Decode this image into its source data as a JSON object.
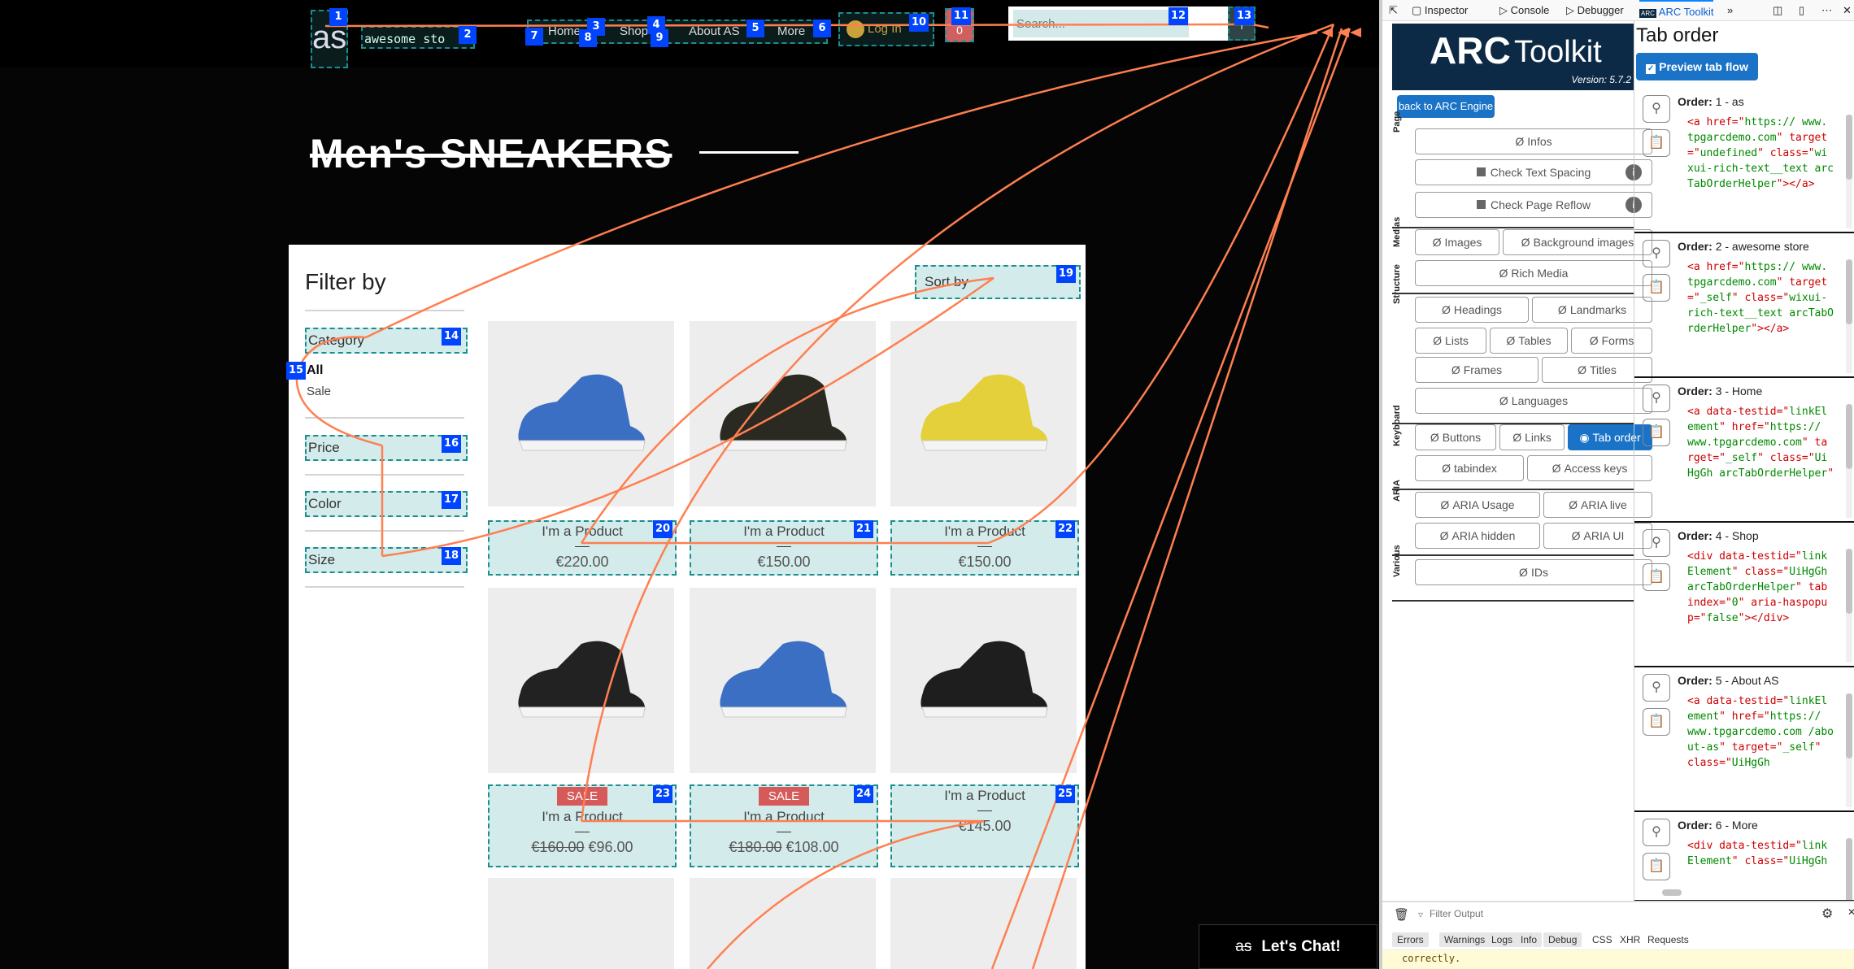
{
  "site": {
    "logo": "as",
    "store_name": "awesome sto",
    "nav": [
      "Home",
      "Shop",
      "About AS",
      "More"
    ],
    "login": "Log In",
    "cart_count": "0",
    "search_placeholder": "Search...",
    "page_title": "Men's SNEAKERS",
    "filter_title": "Filter by",
    "filters": {
      "category": "Category",
      "cat_options": [
        "All",
        "Sale"
      ],
      "price": "Price",
      "color": "Color",
      "size": "Size"
    },
    "sort_label": "Sort by",
    "products": [
      {
        "name": "I'm a Product",
        "price": "€220.00",
        "color": "#3a6fc4"
      },
      {
        "name": "I'm a Product",
        "price": "€150.00",
        "color": "#2b2a22"
      },
      {
        "name": "I'm a Product",
        "price": "€150.00",
        "color": "#e3d03a"
      },
      {
        "name": "I'm a Product",
        "sale": "SALE",
        "old_price": "€160.00",
        "price": "€96.00",
        "color": "#222222"
      },
      {
        "name": "I'm a Product",
        "sale": "SALE",
        "old_price": "€180.00",
        "price": "€108.00",
        "color": "#3a6fc4"
      },
      {
        "name": "I'm a Product",
        "price": "€145.00",
        "color": "#1e1e1e"
      }
    ],
    "chat": {
      "logo": "as",
      "label": "Let's Chat!"
    },
    "tab_badges": [
      "1",
      "2",
      "3",
      "4",
      "5",
      "6",
      "7",
      "8",
      "9",
      "10",
      "11",
      "12",
      "13",
      "14",
      "15",
      "16",
      "17",
      "18",
      "19",
      "20",
      "21",
      "22",
      "23",
      "24",
      "25"
    ],
    "arrow_color": "#ff7f50"
  },
  "devtools": {
    "tabs": [
      "Inspector",
      "Console",
      "Debugger",
      "ARC Toolkit"
    ],
    "active_tab": "ARC Toolkit",
    "arc": {
      "logo_arc": "ARC",
      "logo_toolkit": "Toolkit",
      "version": "Version: 5.7.2",
      "back_button": "back to ARC Engine",
      "sections": {
        "page": "Page",
        "medias": "Medias",
        "structure": "Structure",
        "keyboard": "Keyboard",
        "aria": "ARIA",
        "various": "Various"
      },
      "buttons": {
        "infos": "Infos",
        "text_spacing": "Check Text Spacing",
        "reflow": "Check Page Reflow",
        "images": "Images",
        "bg_images": "Background images",
        "rich_media": "Rich Media",
        "headings": "Headings",
        "landmarks": "Landmarks",
        "lists": "Lists",
        "tables": "Tables",
        "forms": "Forms",
        "frames": "Frames",
        "titles": "Titles",
        "languages": "Languages",
        "buttons": "Buttons",
        "links": "Links",
        "tab_order": "Tab order",
        "tabindex": "tabindex",
        "access_keys": "Access keys",
        "aria_usage": "ARIA Usage",
        "aria_live": "ARIA live",
        "aria_hidden": "ARIA hidden",
        "aria_ui": "ARIA UI",
        "ids": "IDs"
      },
      "active_button": "Tab order",
      "panel_title": "Tab order",
      "preview_label": "Preview tab flow",
      "preview_checked": true,
      "order_label": "Order:",
      "entries": [
        {
          "label": "1 - as",
          "code": [
            [
              "<a href=\"",
              "r"
            ],
            [
              "https:// www.tpgarcdemo.com",
              "g"
            ],
            [
              "\" target=\"",
              "r"
            ],
            [
              "undefined",
              "g"
            ],
            [
              "\" class=\"",
              "r"
            ],
            [
              "wixui-rich-text__text arcTabOrderHelper",
              "g"
            ],
            [
              "\"></a>",
              "r"
            ]
          ]
        },
        {
          "label": "2 - awesome store",
          "code": [
            [
              "<a href=\"",
              "r"
            ],
            [
              "https:// www.tpgarcdemo.com",
              "g"
            ],
            [
              "\" target=\"",
              "r"
            ],
            [
              "_self",
              "g"
            ],
            [
              "\" class=\"",
              "r"
            ],
            [
              "wixui-rich-text__text arcTabOrderHelper",
              "g"
            ],
            [
              "\"></a>",
              "r"
            ]
          ]
        },
        {
          "label": "3 - Home",
          "code": [
            [
              "<a data-testid=\"",
              "r"
            ],
            [
              "linkElement",
              "g"
            ],
            [
              "\" href=\"",
              "r"
            ],
            [
              "https:// www.tpgarcdemo.com",
              "g"
            ],
            [
              "\" target=\"",
              "r"
            ],
            [
              "_self",
              "g"
            ],
            [
              "\" class=\"",
              "r"
            ],
            [
              "UiHgGh arcTabOrderHelper",
              "g"
            ],
            [
              "\"",
              "r"
            ]
          ]
        },
        {
          "label": "4 - Shop",
          "code": [
            [
              "<div data-testid=\"",
              "r"
            ],
            [
              "linkElement",
              "g"
            ],
            [
              "\" class=\"",
              "r"
            ],
            [
              "UiHgGh arcTabOrderHelper",
              "g"
            ],
            [
              "\" tabindex=\"",
              "r"
            ],
            [
              "0",
              "g"
            ],
            [
              "\" aria-haspopup=\"",
              "r"
            ],
            [
              "false",
              "g"
            ],
            [
              "\"></div>",
              "r"
            ]
          ]
        },
        {
          "label": "5 - About AS",
          "code": [
            [
              "<a data-testid=\"",
              "r"
            ],
            [
              "linkElement",
              "g"
            ],
            [
              "\" href=\"",
              "r"
            ],
            [
              "https:// www.tpgarcdemo.com /about-as",
              "g"
            ],
            [
              "\" target=\"",
              "r"
            ],
            [
              "_self",
              "g"
            ],
            [
              "\" class=\"",
              "r"
            ],
            [
              "UiHgGh",
              "g"
            ]
          ]
        },
        {
          "label": "6 - More",
          "code": [
            [
              "<div data-testid=\"",
              "r"
            ],
            [
              "linkElement",
              "g"
            ],
            [
              "\" class=\"",
              "r"
            ],
            [
              "UiHgGh",
              "g"
            ]
          ]
        }
      ]
    },
    "console": {
      "filter_placeholder": "Filter Output",
      "filters": [
        "Errors",
        "Warnings",
        "Logs",
        "Info",
        "Debug"
      ],
      "types": [
        "CSS",
        "XHR",
        "Requests"
      ],
      "message": "correctly."
    }
  }
}
